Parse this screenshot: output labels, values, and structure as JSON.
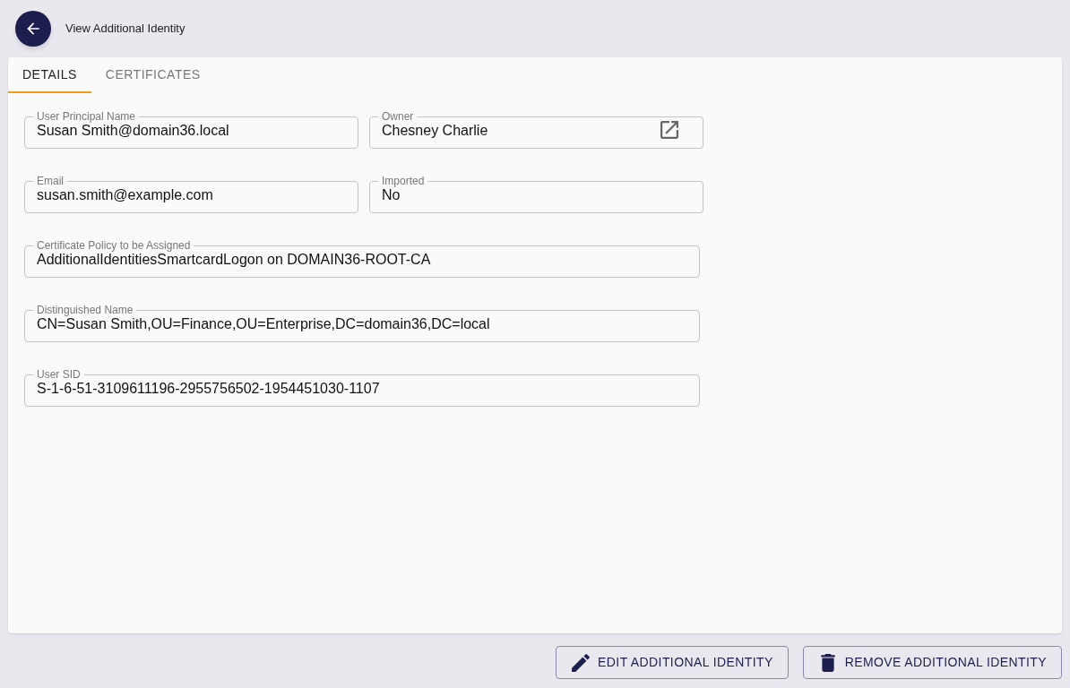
{
  "header": {
    "title": "View Additional Identity"
  },
  "tabs": [
    {
      "label": "DETAILS",
      "selected": true
    },
    {
      "label": "CERTIFICATES",
      "selected": false
    }
  ],
  "form_rows": [
    [
      {
        "label": "User Principal Name",
        "value": "Susan Smith@domain36.local",
        "kind": "text"
      },
      {
        "label": "Owner",
        "value": "Chesney Charlie",
        "kind": "link"
      }
    ],
    [
      {
        "label": "Email",
        "value": "susan.smith@example.com",
        "kind": "text"
      },
      {
        "label": "Imported",
        "value": "No",
        "kind": "text"
      }
    ],
    [
      {
        "label": "Certificate Policy to be Assigned",
        "value": "AdditionalIdentitiesSmartcardLogon on DOMAIN36-ROOT-CA",
        "kind": "text"
      }
    ],
    [
      {
        "label": "Distinguished Name",
        "value": "CN=Susan Smith,OU=Finance,OU=Enterprise,DC=domain36,DC=local",
        "kind": "text"
      }
    ],
    [
      {
        "label": "User SID",
        "value": "S-1-6-51-3109611196-2955756502-1954451030-1107",
        "kind": "text"
      }
    ]
  ],
  "actions": [
    {
      "label": "EDIT ADDITIONAL IDENTITY",
      "kind": "edit"
    },
    {
      "label": "REMOVE ADDITIONAL IDENTITY",
      "kind": "remove"
    }
  ]
}
